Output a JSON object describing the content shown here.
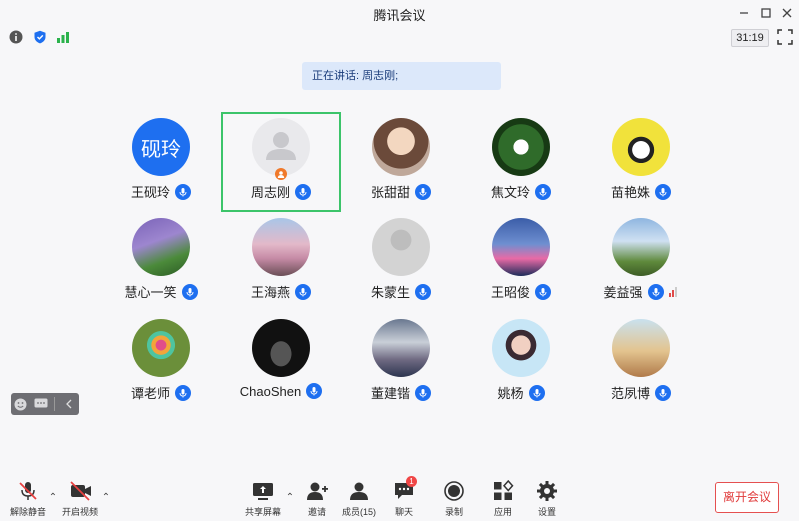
{
  "app": {
    "title": "腾讯会议"
  },
  "infobar": {
    "timer": "31:19"
  },
  "banner": {
    "speaking": "正在讲话: 周志刚;"
  },
  "participants": [
    {
      "name": "王砚玲",
      "avatar_text": "砚玲",
      "avatar_color": "#1e6ff0"
    },
    {
      "name": "周志刚",
      "avatar_text": "",
      "host": true,
      "active": true
    },
    {
      "name": "张甜甜"
    },
    {
      "name": "焦文玲"
    },
    {
      "name": "苗艳姝"
    },
    {
      "name": "慧心一笑"
    },
    {
      "name": "王海燕"
    },
    {
      "name": "朱蒙生"
    },
    {
      "name": "王昭俊"
    },
    {
      "name": "姜益强"
    },
    {
      "name": "谭老师"
    },
    {
      "name": "ChaoShen"
    },
    {
      "name": "董建锴"
    },
    {
      "name": "姚杨"
    },
    {
      "name": "范夙博"
    }
  ],
  "toolbar": {
    "unmute": "解除静音",
    "start_video": "开启视频",
    "share_screen": "共享屏幕",
    "invite": "邀请",
    "members": "成员(15)",
    "chat": "聊天",
    "chat_badge": "1",
    "record": "录制",
    "apps": "应用",
    "settings": "设置",
    "leave": "离开会议"
  },
  "colors": {
    "accent": "#1e6ff0",
    "active_border": "#3cc46a",
    "leave": "#e03b3b"
  }
}
